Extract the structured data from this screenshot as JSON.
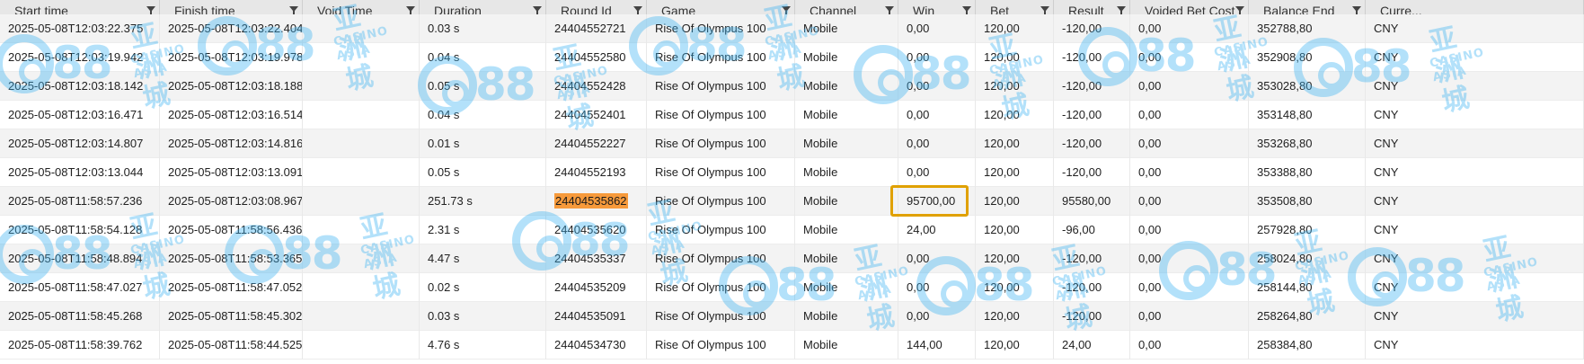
{
  "table": {
    "columns": [
      {
        "key": "start",
        "label": "Start time"
      },
      {
        "key": "finish",
        "label": "Finish time"
      },
      {
        "key": "void",
        "label": "Void Time"
      },
      {
        "key": "duration",
        "label": "Duration"
      },
      {
        "key": "round",
        "label": "Round Id"
      },
      {
        "key": "game",
        "label": "Game"
      },
      {
        "key": "channel",
        "label": "Channel"
      },
      {
        "key": "win",
        "label": "Win"
      },
      {
        "key": "bet",
        "label": "Bet"
      },
      {
        "key": "result",
        "label": "Result"
      },
      {
        "key": "voided_cost",
        "label": "Voided Bet Cost"
      },
      {
        "key": "balance",
        "label": "Balance End"
      },
      {
        "key": "currency",
        "label": "Curre..."
      }
    ],
    "rows": [
      {
        "start": "2025-05-08T12:03:22.375",
        "finish": "2025-05-08T12:03:22.404",
        "void": "",
        "duration": "0.03 s",
        "round": "24404552721",
        "game": "Rise Of Olympus 100",
        "channel": "Mobile",
        "win": "0,00",
        "bet": "120,00",
        "result": "-120,00",
        "voided_cost": "0,00",
        "balance": "352788,80",
        "currency": "CNY"
      },
      {
        "start": "2025-05-08T12:03:19.942",
        "finish": "2025-05-08T12:03:19.978",
        "void": "",
        "duration": "0.04 s",
        "round": "24404552580",
        "game": "Rise Of Olympus 100",
        "channel": "Mobile",
        "win": "0,00",
        "bet": "120,00",
        "result": "-120,00",
        "voided_cost": "0,00",
        "balance": "352908,80",
        "currency": "CNY"
      },
      {
        "start": "2025-05-08T12:03:18.142",
        "finish": "2025-05-08T12:03:18.188",
        "void": "",
        "duration": "0.05 s",
        "round": "24404552428",
        "game": "Rise Of Olympus 100",
        "channel": "Mobile",
        "win": "0,00",
        "bet": "120,00",
        "result": "-120,00",
        "voided_cost": "0,00",
        "balance": "353028,80",
        "currency": "CNY"
      },
      {
        "start": "2025-05-08T12:03:16.471",
        "finish": "2025-05-08T12:03:16.514",
        "void": "",
        "duration": "0.04 s",
        "round": "24404552401",
        "game": "Rise Of Olympus 100",
        "channel": "Mobile",
        "win": "0,00",
        "bet": "120,00",
        "result": "-120,00",
        "voided_cost": "0,00",
        "balance": "353148,80",
        "currency": "CNY"
      },
      {
        "start": "2025-05-08T12:03:14.807",
        "finish": "2025-05-08T12:03:14.816",
        "void": "",
        "duration": "0.01 s",
        "round": "24404552227",
        "game": "Rise Of Olympus 100",
        "channel": "Mobile",
        "win": "0,00",
        "bet": "120,00",
        "result": "-120,00",
        "voided_cost": "0,00",
        "balance": "353268,80",
        "currency": "CNY"
      },
      {
        "start": "2025-05-08T12:03:13.044",
        "finish": "2025-05-08T12:03:13.091",
        "void": "",
        "duration": "0.05 s",
        "round": "24404552193",
        "game": "Rise Of Olympus 100",
        "channel": "Mobile",
        "win": "0,00",
        "bet": "120,00",
        "result": "-120,00",
        "voided_cost": "0,00",
        "balance": "353388,80",
        "currency": "CNY"
      },
      {
        "start": "2025-05-08T11:58:57.236",
        "finish": "2025-05-08T12:03:08.967",
        "void": "",
        "duration": "251.73 s",
        "round": "24404535862",
        "game": "Rise Of Olympus 100",
        "channel": "Mobile",
        "win": "95700,00",
        "bet": "120,00",
        "result": "95580,00",
        "voided_cost": "0,00",
        "balance": "353508,80",
        "currency": "CNY",
        "highlight": true
      },
      {
        "start": "2025-05-08T11:58:54.128",
        "finish": "2025-05-08T11:58:56.436",
        "void": "",
        "duration": "2.31 s",
        "round": "24404535620",
        "game": "Rise Of Olympus 100",
        "channel": "Mobile",
        "win": "24,00",
        "bet": "120,00",
        "result": "-96,00",
        "voided_cost": "0,00",
        "balance": "257928,80",
        "currency": "CNY"
      },
      {
        "start": "2025-05-08T11:58:48.894",
        "finish": "2025-05-08T11:58:53.365",
        "void": "",
        "duration": "4.47 s",
        "round": "24404535337",
        "game": "Rise Of Olympus 100",
        "channel": "Mobile",
        "win": "0,00",
        "bet": "120,00",
        "result": "-120,00",
        "voided_cost": "0,00",
        "balance": "258024,80",
        "currency": "CNY"
      },
      {
        "start": "2025-05-08T11:58:47.027",
        "finish": "2025-05-08T11:58:47.052",
        "void": "",
        "duration": "0.02 s",
        "round": "24404535209",
        "game": "Rise Of Olympus 100",
        "channel": "Mobile",
        "win": "0,00",
        "bet": "120,00",
        "result": "-120,00",
        "voided_cost": "0,00",
        "balance": "258144,80",
        "currency": "CNY"
      },
      {
        "start": "2025-05-08T11:58:45.268",
        "finish": "2025-05-08T11:58:45.302",
        "void": "",
        "duration": "0.03 s",
        "round": "24404535091",
        "game": "Rise Of Olympus 100",
        "channel": "Mobile",
        "win": "0,00",
        "bet": "120,00",
        "result": "-120,00",
        "voided_cost": "0,00",
        "balance": "258264,80",
        "currency": "CNY"
      },
      {
        "start": "2025-05-08T11:58:39.762",
        "finish": "2025-05-08T11:58:44.525",
        "void": "",
        "duration": "4.76 s",
        "round": "24404534730",
        "game": "Rise Of Olympus 100",
        "channel": "Mobile",
        "win": "144,00",
        "bet": "120,00",
        "result": "24,00",
        "voided_cost": "0,00",
        "balance": "258384,80",
        "currency": "CNY"
      }
    ]
  },
  "watermark": {
    "number": "88",
    "chinese": "亚洲城",
    "english": "CASINO ASIA"
  },
  "icons": {
    "filter": "filter-funnel-icon",
    "watermark": "ca88-logo-icon"
  },
  "colors": {
    "header_bg": "#e7e7e7",
    "row_odd_bg": "#f3f3f3",
    "row_even_bg": "#ffffff",
    "round_highlight": "#f79a3b",
    "win_outline": "#e0a100",
    "watermark": "#3ab2f2"
  }
}
